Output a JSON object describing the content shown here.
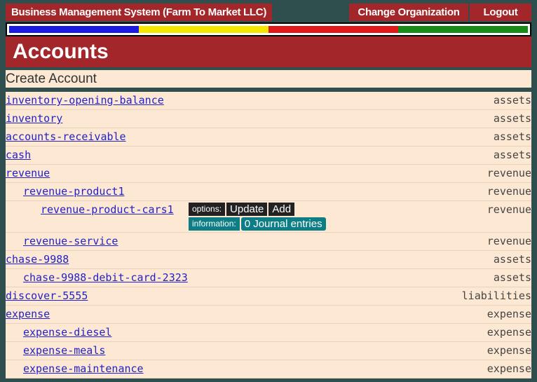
{
  "header": {
    "brand": "Business Management System (Farm To Market LLC)",
    "change_org": "Change Organization",
    "logout": "Logout"
  },
  "stripe_colors": [
    "#1a1ae0",
    "#f5e600",
    "#e01a1a",
    "#1a8a1a"
  ],
  "page_title": "Accounts",
  "create_label": "Create Account",
  "accounts": [
    {
      "name": "inventory-opening-balance",
      "type": "assets"
    },
    {
      "name": "inventory",
      "type": "assets"
    },
    {
      "name": "accounts-receivable",
      "type": "assets"
    },
    {
      "name": "cash",
      "type": "assets"
    },
    {
      "name": "revenue",
      "type": "revenue"
    },
    {
      "name": "revenue-product1",
      "type": "revenue"
    },
    {
      "name": "revenue-product-cars1",
      "type": "revenue"
    },
    {
      "name": "revenue-service",
      "type": "revenue"
    },
    {
      "name": "chase-9988",
      "type": "assets"
    },
    {
      "name": "chase-9988-debit-card-2323",
      "type": "assets"
    },
    {
      "name": "discover-5555",
      "type": "liabilities"
    },
    {
      "name": "expense",
      "type": "expense"
    },
    {
      "name": "expense-diesel",
      "type": "expense"
    },
    {
      "name": "expense-meals",
      "type": "expense"
    },
    {
      "name": "expense-maintenance",
      "type": "expense"
    }
  ],
  "options": {
    "options_label": "options:",
    "update": "Update",
    "add": "Add",
    "info_label": "information:",
    "journal": "0 Journal entries"
  }
}
